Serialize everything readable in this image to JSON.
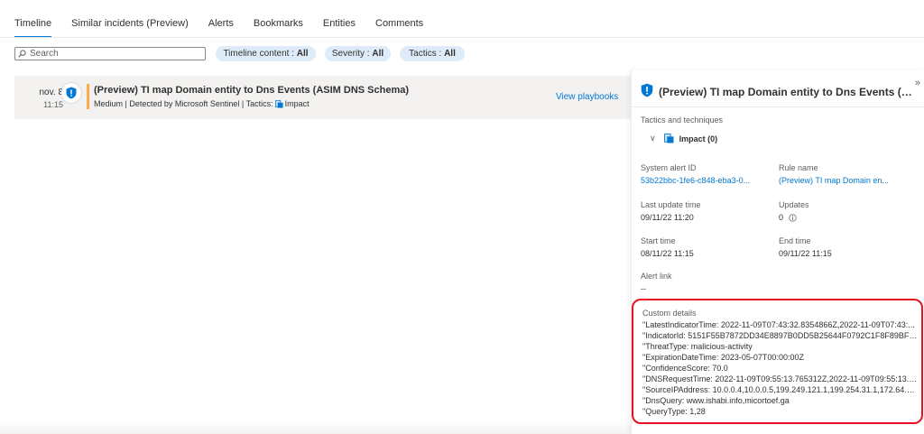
{
  "tabs": [
    {
      "label": "Timeline",
      "active": true
    },
    {
      "label": "Similar incidents (Preview)"
    },
    {
      "label": "Alerts"
    },
    {
      "label": "Bookmarks"
    },
    {
      "label": "Entities"
    },
    {
      "label": "Comments"
    }
  ],
  "filters": {
    "search_placeholder": "Search",
    "timeline_content": {
      "label": "Timeline content : ",
      "value": "All"
    },
    "severity": {
      "label": "Severity : ",
      "value": "All"
    },
    "tactics": {
      "label": "Tactics : ",
      "value": "All"
    }
  },
  "timeline_item": {
    "date": "nov. 8",
    "time": "11:15",
    "title": "(Preview) TI map Domain entity to Dns Events (ASIM DNS Schema)",
    "subtitle": "Medium | Detected by Microsoft Sentinel | Tactics:",
    "tactic": "Impact",
    "playbooks_link": "View playbooks",
    "severity_color": "#ffaa44"
  },
  "panel": {
    "title": "(Preview) TI map Domain entity to Dns Events (ASIM D...",
    "tactics_label": "Tactics and techniques",
    "tactic_item": "Impact (0)",
    "system_alert_id_label": "System alert ID",
    "system_alert_id": "53b22bbc-1fe6-c848-eba3-0...",
    "rule_name_label": "Rule name",
    "rule_name": "(Preview) TI map Domain en...",
    "last_update_label": "Last update time",
    "last_update": "09/11/22 11:20",
    "updates_label": "Updates",
    "updates": "0",
    "start_time_label": "Start time",
    "start_time": "08/11/22 11:15",
    "end_time_label": "End time",
    "end_time": "09/11/22 11:15",
    "alert_link_label": "Alert link",
    "alert_link": "--",
    "custom_details_label": "Custom details",
    "custom_details": [
      "\"LatestIndicatorTime: 2022-11-09T07:43:32.8354866Z,2022-11-09T07:43:...",
      "\"IndicatorId: 5151F55B7872DD34E8897B0DD5B25644F0792C1F8F89BF11...",
      "\"ThreatType: malicious-activity",
      "\"ExpirationDateTime: 2023-05-07T00:00:00Z",
      "\"ConfidenceScore: 70.0",
      "\"DNSRequestTime: 2022-11-09T09:55:13.765312Z,2022-11-09T09:55:13.7...",
      "\"SourceIPAddress: 10.0.0.4,10.0.0.5,199.249.121.1,199.254.31.1,172.64.34.2...",
      "\"DnsQuery: www.ishabi.info,micortoef.ga",
      "\"QueryType: 1,28"
    ]
  },
  "colors": {
    "accent": "#0078d4",
    "highlight_border": "#e81123"
  }
}
